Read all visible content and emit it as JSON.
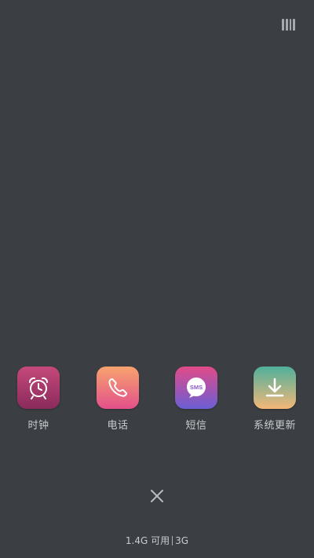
{
  "apps": [
    {
      "label": "时钟",
      "icon": "alarm-clock-icon",
      "gradient": [
        "#c4497a",
        "#8a2b5c"
      ]
    },
    {
      "label": "电话",
      "icon": "phone-icon",
      "gradient": [
        "#f7a36e",
        "#e3508a"
      ]
    },
    {
      "label": "短信",
      "icon": "sms-bubble-icon",
      "bubble_text": "SMS",
      "gradient": [
        "#e14b89",
        "#6b5ed4"
      ]
    },
    {
      "label": "系统更新",
      "icon": "download-icon",
      "gradient": [
        "#4fb09b",
        "#f4b778"
      ]
    }
  ],
  "status": {
    "memory_text": "1.4G 可用",
    "network_text": "3G"
  },
  "colors": {
    "background": "#3b3e42",
    "text": "#c9cbce"
  }
}
